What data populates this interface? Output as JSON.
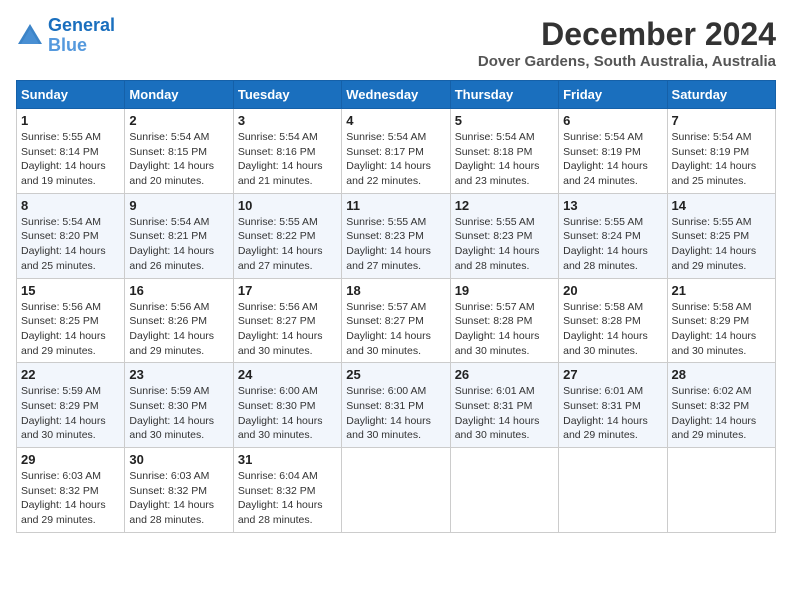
{
  "header": {
    "logo_line1": "General",
    "logo_line2": "Blue",
    "month_year": "December 2024",
    "location": "Dover Gardens, South Australia, Australia"
  },
  "days_of_week": [
    "Sunday",
    "Monday",
    "Tuesday",
    "Wednesday",
    "Thursday",
    "Friday",
    "Saturday"
  ],
  "weeks": [
    [
      {
        "day": "1",
        "sunrise": "5:55 AM",
        "sunset": "8:14 PM",
        "daylight": "14 hours and 19 minutes."
      },
      {
        "day": "2",
        "sunrise": "5:54 AM",
        "sunset": "8:15 PM",
        "daylight": "14 hours and 20 minutes."
      },
      {
        "day": "3",
        "sunrise": "5:54 AM",
        "sunset": "8:16 PM",
        "daylight": "14 hours and 21 minutes."
      },
      {
        "day": "4",
        "sunrise": "5:54 AM",
        "sunset": "8:17 PM",
        "daylight": "14 hours and 22 minutes."
      },
      {
        "day": "5",
        "sunrise": "5:54 AM",
        "sunset": "8:18 PM",
        "daylight": "14 hours and 23 minutes."
      },
      {
        "day": "6",
        "sunrise": "5:54 AM",
        "sunset": "8:19 PM",
        "daylight": "14 hours and 24 minutes."
      },
      {
        "day": "7",
        "sunrise": "5:54 AM",
        "sunset": "8:19 PM",
        "daylight": "14 hours and 25 minutes."
      }
    ],
    [
      {
        "day": "8",
        "sunrise": "5:54 AM",
        "sunset": "8:20 PM",
        "daylight": "14 hours and 25 minutes."
      },
      {
        "day": "9",
        "sunrise": "5:54 AM",
        "sunset": "8:21 PM",
        "daylight": "14 hours and 26 minutes."
      },
      {
        "day": "10",
        "sunrise": "5:55 AM",
        "sunset": "8:22 PM",
        "daylight": "14 hours and 27 minutes."
      },
      {
        "day": "11",
        "sunrise": "5:55 AM",
        "sunset": "8:23 PM",
        "daylight": "14 hours and 27 minutes."
      },
      {
        "day": "12",
        "sunrise": "5:55 AM",
        "sunset": "8:23 PM",
        "daylight": "14 hours and 28 minutes."
      },
      {
        "day": "13",
        "sunrise": "5:55 AM",
        "sunset": "8:24 PM",
        "daylight": "14 hours and 28 minutes."
      },
      {
        "day": "14",
        "sunrise": "5:55 AM",
        "sunset": "8:25 PM",
        "daylight": "14 hours and 29 minutes."
      }
    ],
    [
      {
        "day": "15",
        "sunrise": "5:56 AM",
        "sunset": "8:25 PM",
        "daylight": "14 hours and 29 minutes."
      },
      {
        "day": "16",
        "sunrise": "5:56 AM",
        "sunset": "8:26 PM",
        "daylight": "14 hours and 29 minutes."
      },
      {
        "day": "17",
        "sunrise": "5:56 AM",
        "sunset": "8:27 PM",
        "daylight": "14 hours and 30 minutes."
      },
      {
        "day": "18",
        "sunrise": "5:57 AM",
        "sunset": "8:27 PM",
        "daylight": "14 hours and 30 minutes."
      },
      {
        "day": "19",
        "sunrise": "5:57 AM",
        "sunset": "8:28 PM",
        "daylight": "14 hours and 30 minutes."
      },
      {
        "day": "20",
        "sunrise": "5:58 AM",
        "sunset": "8:28 PM",
        "daylight": "14 hours and 30 minutes."
      },
      {
        "day": "21",
        "sunrise": "5:58 AM",
        "sunset": "8:29 PM",
        "daylight": "14 hours and 30 minutes."
      }
    ],
    [
      {
        "day": "22",
        "sunrise": "5:59 AM",
        "sunset": "8:29 PM",
        "daylight": "14 hours and 30 minutes."
      },
      {
        "day": "23",
        "sunrise": "5:59 AM",
        "sunset": "8:30 PM",
        "daylight": "14 hours and 30 minutes."
      },
      {
        "day": "24",
        "sunrise": "6:00 AM",
        "sunset": "8:30 PM",
        "daylight": "14 hours and 30 minutes."
      },
      {
        "day": "25",
        "sunrise": "6:00 AM",
        "sunset": "8:31 PM",
        "daylight": "14 hours and 30 minutes."
      },
      {
        "day": "26",
        "sunrise": "6:01 AM",
        "sunset": "8:31 PM",
        "daylight": "14 hours and 30 minutes."
      },
      {
        "day": "27",
        "sunrise": "6:01 AM",
        "sunset": "8:31 PM",
        "daylight": "14 hours and 29 minutes."
      },
      {
        "day": "28",
        "sunrise": "6:02 AM",
        "sunset": "8:32 PM",
        "daylight": "14 hours and 29 minutes."
      }
    ],
    [
      {
        "day": "29",
        "sunrise": "6:03 AM",
        "sunset": "8:32 PM",
        "daylight": "14 hours and 29 minutes."
      },
      {
        "day": "30",
        "sunrise": "6:03 AM",
        "sunset": "8:32 PM",
        "daylight": "14 hours and 28 minutes."
      },
      {
        "day": "31",
        "sunrise": "6:04 AM",
        "sunset": "8:32 PM",
        "daylight": "14 hours and 28 minutes."
      },
      null,
      null,
      null,
      null
    ]
  ]
}
